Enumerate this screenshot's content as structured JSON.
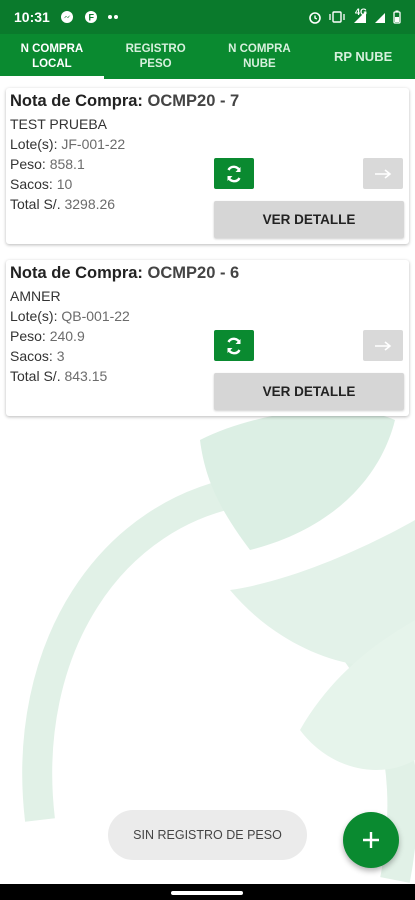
{
  "status_bar": {
    "time": "10:31",
    "left_icons": [
      "messenger-icon",
      "app-icon",
      "more-dots-icon"
    ],
    "right_icons": [
      "alarm-icon",
      "vibrate-icon",
      "signal-4g-icon",
      "signal-bars-icon",
      "battery-icon"
    ],
    "network": "4G"
  },
  "tabs": [
    {
      "label": "N COMPRA\nLOCAL",
      "active": true
    },
    {
      "label": "REGISTRO\nPESO",
      "active": false
    },
    {
      "label": "N COMPRA\nNUBE",
      "active": false
    },
    {
      "label": "RP NUBE",
      "active": false
    }
  ],
  "cards": [
    {
      "title_prefix": "Nota de Compra: ",
      "title_code": "OCMP20 - 7",
      "name": "TEST PRUEBA",
      "lote_label": "Lote(s): ",
      "lote": "JF-001-22",
      "peso_label": "Peso: ",
      "peso": "858.1",
      "sacos_label": "Sacos: ",
      "sacos": "10",
      "total_label": "Total S/. ",
      "total": "3298.26",
      "detail_label": "VER DETALLE"
    },
    {
      "title_prefix": "Nota de Compra: ",
      "title_code": "OCMP20 - 6",
      "name": "AMNER",
      "lote_label": "Lote(s): ",
      "lote": "QB-001-22",
      "peso_label": "Peso: ",
      "peso": "240.9",
      "sacos_label": "Sacos: ",
      "sacos": "3",
      "total_label": "Total S/. ",
      "total": "843.15",
      "detail_label": "VER DETALLE"
    }
  ],
  "pill_label": "SIN REGISTRO DE PESO",
  "colors": {
    "status_bar": "#0a7a2c",
    "primary": "#0a8a30",
    "button_grey": "#d6d6d6",
    "background_art": "#dcefe4"
  }
}
